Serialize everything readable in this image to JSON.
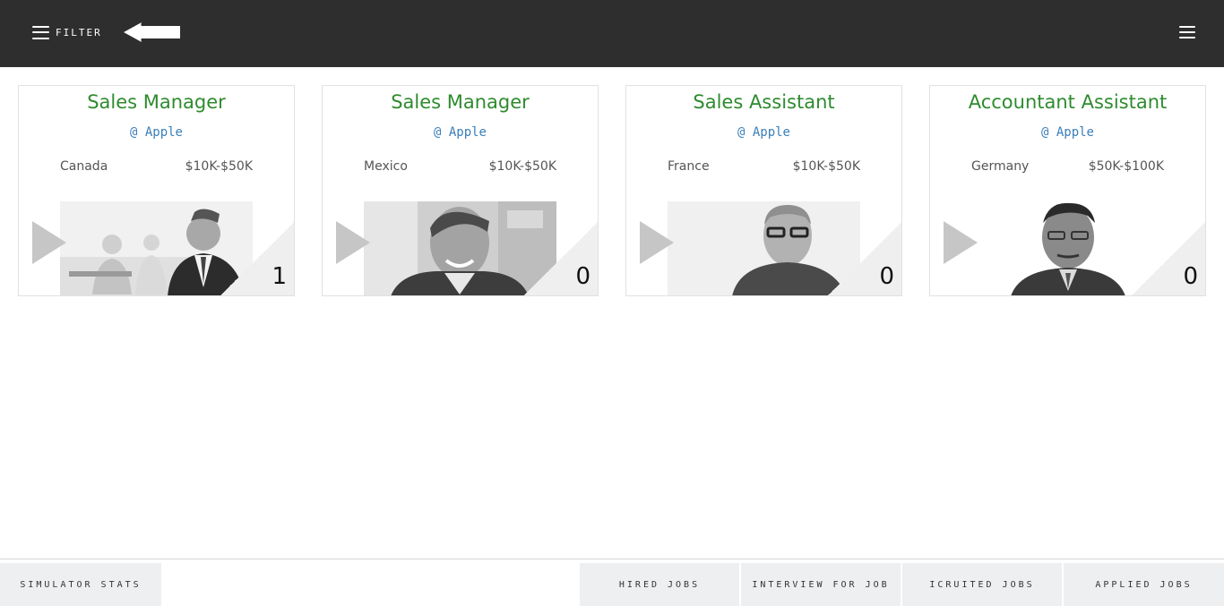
{
  "topbar": {
    "filter_label": "FILTER"
  },
  "jobs": [
    {
      "title": "Sales Manager",
      "company": "@ Apple",
      "location": "Canada",
      "salary": "$10K-$50K",
      "count": "1"
    },
    {
      "title": "Sales Manager",
      "company": "@ Apple",
      "location": "Mexico",
      "salary": "$10K-$50K",
      "count": "0"
    },
    {
      "title": "Sales Assistant",
      "company": "@ Apple",
      "location": "France",
      "salary": "$10K-$50K",
      "count": "0"
    },
    {
      "title": "Accountant Assistant",
      "company": "@ Apple",
      "location": "Germany",
      "salary": "$50K-$100K",
      "count": "0"
    }
  ],
  "bottombar": {
    "simulator_stats": "SIMULATOR STATS",
    "hired_jobs": "HIRED JOBS",
    "interview_for_job": "INTERVIEW FOR JOB",
    "recruited_jobs": "ICRUITED JOBS",
    "applied_jobs": "APPLIED JOBS"
  },
  "colors": {
    "topbar": "#2e2e2e",
    "title": "#2e8b2e",
    "company": "#3b7fb8",
    "tab": "#eeeff1"
  }
}
